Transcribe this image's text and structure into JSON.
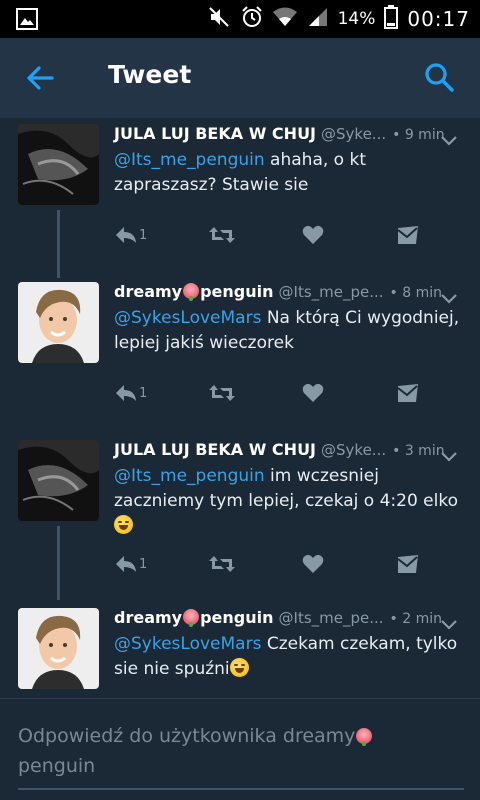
{
  "status_bar": {
    "battery_percent": "14%",
    "clock": "00:17",
    "icons": [
      "gallery-icon",
      "mute-icon",
      "alarm-icon",
      "wifi-icon",
      "signal-icon",
      "battery-icon"
    ]
  },
  "app_bar": {
    "title": "Tweet",
    "back_icon": "arrow-left-icon",
    "search_icon": "search-icon",
    "accent": "#1da1f2"
  },
  "tweets": [
    {
      "name": "JULA LUJ BEKA W CHUJ",
      "handle": "@Syke...",
      "time": "• 9 min",
      "mention": "@Its_me_penguin",
      "text": " ahaha, o kt zapraszasz? Stawie sie",
      "reply_count": "1",
      "avatar": "dark-photo"
    },
    {
      "name_pre": "dreamy",
      "name_post": "penguin",
      "handle": "@Its_me_pe...",
      "time": "• 8 min",
      "mention": "@SykesLoveMars",
      "text": " Na którą Ci wygodniej, lepiej jakiś wieczorek",
      "reply_count": "1",
      "avatar": "boy-photo"
    },
    {
      "name": "JULA LUJ BEKA W CHUJ",
      "handle": "@Syke...",
      "time": "• 3 min",
      "mention": "@Its_me_penguin",
      "text": " im wczesniej zaczniemy tym lepiej, czekaj o 4:20 elko",
      "reply_count": "1",
      "avatar": "dark-photo"
    },
    {
      "name_pre": "dreamy",
      "name_post": "penguin",
      "handle": "@Its_me_pe...",
      "time": "• 2 min",
      "mention": "@SykesLoveMars",
      "text": " Czekam czekam, tylko sie nie spuźni",
      "reply_count": "",
      "avatar": "boy-photo"
    }
  ],
  "reply_box": {
    "placeholder_pre": "Odpowiedź do użytkownika dreamy",
    "placeholder_post": "penguin"
  },
  "colors": {
    "background": "#1b2836",
    "app_bar": "#243447",
    "mention": "#3aa3e6",
    "muted": "#8899a6"
  }
}
